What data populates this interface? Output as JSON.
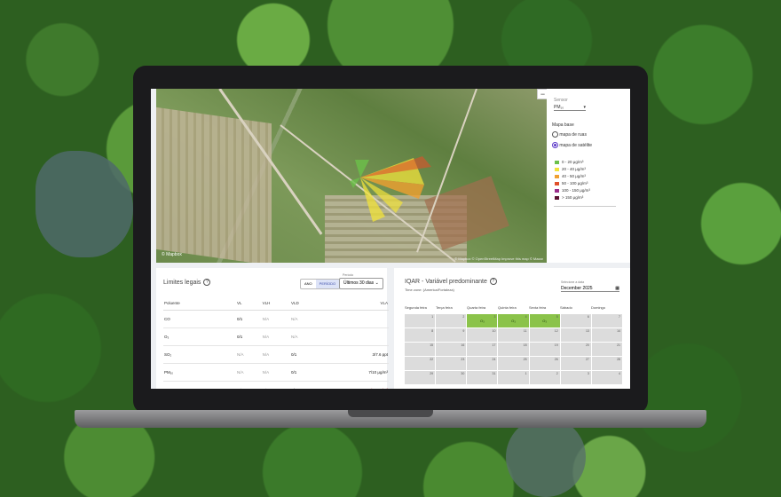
{
  "colors": {
    "accent": "#5b39c7",
    "good": "#8bc34a"
  },
  "map": {
    "zoom_out": "−",
    "logo": "© Mapbox",
    "attribution": "© Mapbox © OpenStreetMap Improve this map © Maxar"
  },
  "side": {
    "sensor_label": "Sensor",
    "sensor_value": "PM₁₀",
    "basemap_label": "Mapa base",
    "options": [
      "mapa de ruas",
      "mapa de satélite"
    ],
    "selected_option": 1,
    "legend": [
      {
        "label": "0 - 20 μg/m³",
        "color": "#6cc04a"
      },
      {
        "label": "20 - 40 μg/m³",
        "color": "#f2e33b"
      },
      {
        "label": "40 - 50 μg/m³",
        "color": "#f0a030"
      },
      {
        "label": "50 - 100 μg/m³",
        "color": "#e0502a"
      },
      {
        "label": "100 - 150 μg/m³",
        "color": "#9b2c8a"
      },
      {
        "label": "> 150 μg/m³",
        "color": "#5a1030"
      }
    ]
  },
  "limits": {
    "title": "Limites legais",
    "info_icon": "?",
    "toggle": [
      "ANO",
      "PERÍODO"
    ],
    "period_label": "Período",
    "period_value": "Últimos 30 dias",
    "columns": [
      "Poluente",
      "VL",
      "VLH",
      "VLD",
      "VLA"
    ],
    "rows": [
      {
        "pollutant": "CO",
        "vl": "0/1",
        "vlh": "N/A",
        "vld": "N/A",
        "vla": ""
      },
      {
        "pollutant": "O₃",
        "vl": "0/1",
        "vlh": "N/A",
        "vld": "N/A",
        "vla": ""
      },
      {
        "pollutant": "SO₂",
        "vl": "N/A",
        "vlh": "N/A",
        "vld": "0/1",
        "vla": "3/7.6 ppt"
      },
      {
        "pollutant": "PM₁₀",
        "vl": "N/A",
        "vlh": "N/A",
        "vld": "0/1",
        "vla": "7/10 μg/m³"
      },
      {
        "pollutant": "PM₂.₅",
        "vl": "N/A",
        "vlh": "N/A",
        "vld": "0/1",
        "vla": "32/30 μg/m³"
      }
    ]
  },
  "iqar": {
    "title": "IQAR - Variável predominante",
    "info_icon": "?",
    "timezone": "Time zone: (America/Fortaleza)",
    "date_label": "Selecione a data",
    "date_value": "December 2025",
    "weekdays": [
      "Segunda feira",
      "Terça feira",
      "Quarta feira",
      "Quinta feira",
      "Sexta feira",
      "Sábado",
      "Domingo"
    ],
    "cells": [
      {
        "day": "1",
        "value": ""
      },
      {
        "day": "2",
        "value": ""
      },
      {
        "day": "3",
        "value": "O₃"
      },
      {
        "day": "4",
        "value": "O₃"
      },
      {
        "day": "5",
        "value": "O₃"
      },
      {
        "day": "6",
        "value": ""
      },
      {
        "day": "7",
        "value": ""
      },
      {
        "day": "8",
        "value": ""
      },
      {
        "day": "9",
        "value": ""
      },
      {
        "day": "10",
        "value": ""
      },
      {
        "day": "11",
        "value": ""
      },
      {
        "day": "12",
        "value": ""
      },
      {
        "day": "13",
        "value": ""
      },
      {
        "day": "14",
        "value": ""
      },
      {
        "day": "15",
        "value": ""
      },
      {
        "day": "16",
        "value": ""
      },
      {
        "day": "17",
        "value": ""
      },
      {
        "day": "18",
        "value": ""
      },
      {
        "day": "19",
        "value": ""
      },
      {
        "day": "20",
        "value": ""
      },
      {
        "day": "21",
        "value": ""
      },
      {
        "day": "22",
        "value": ""
      },
      {
        "day": "23",
        "value": ""
      },
      {
        "day": "24",
        "value": ""
      },
      {
        "day": "25",
        "value": ""
      },
      {
        "day": "26",
        "value": ""
      },
      {
        "day": "27",
        "value": ""
      },
      {
        "day": "28",
        "value": ""
      },
      {
        "day": "29",
        "value": ""
      },
      {
        "day": "30",
        "value": ""
      },
      {
        "day": "31",
        "value": ""
      },
      {
        "day": "1",
        "value": ""
      },
      {
        "day": "2",
        "value": ""
      },
      {
        "day": "3",
        "value": ""
      },
      {
        "day": "4",
        "value": ""
      }
    ]
  }
}
